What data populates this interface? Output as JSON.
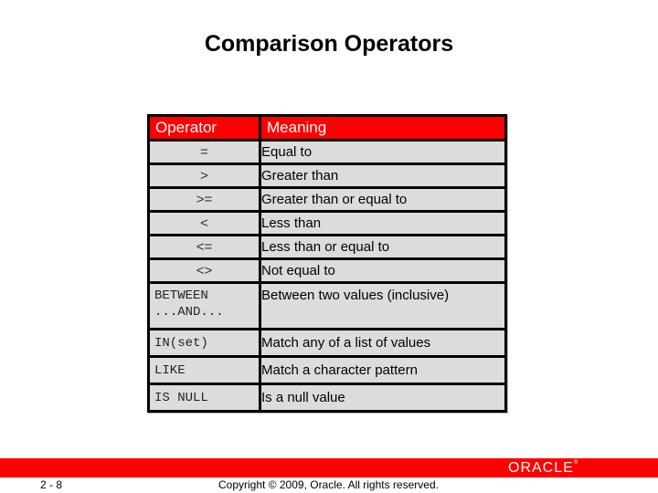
{
  "title": "Comparison Operators",
  "table": {
    "headers": [
      "Operator",
      "Meaning"
    ],
    "rows": [
      {
        "operator": "=",
        "meaning": "Equal to"
      },
      {
        "operator": ">",
        "meaning": "Greater than"
      },
      {
        "operator": ">=",
        "meaning": "Greater than or equal to"
      },
      {
        "operator": "<",
        "meaning": "Less than"
      },
      {
        "operator": "<=",
        "meaning": "Less than or equal to"
      },
      {
        "operator": "<>",
        "meaning": "Not equal to"
      },
      {
        "operator": "BETWEEN\n...AND...",
        "meaning": "Between two values (inclusive)"
      },
      {
        "operator": "IN(set)",
        "meaning": "Match any of a list of values"
      },
      {
        "operator": "LIKE",
        "meaning": "Match a character pattern"
      },
      {
        "operator": "IS NULL",
        "meaning": "Is a null value"
      }
    ]
  },
  "footer": {
    "page_number": "2 - 8",
    "copyright": "Copyright © 2009, Oracle. All rights reserved.",
    "logo_text": "ORACLE",
    "logo_mark": "®",
    "bar_color": "#ff0000"
  },
  "colors": {
    "header_bg": "#ff0000",
    "cell_bg": "#dcdcdc",
    "border": "#000000"
  }
}
